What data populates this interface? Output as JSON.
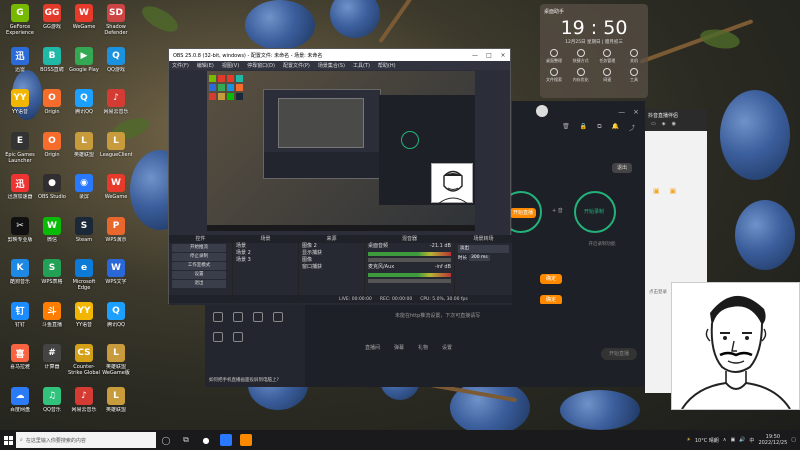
{
  "desktop_icons": [
    {
      "label": "GeForce Experience",
      "color": "#76b900",
      "glyph": "G"
    },
    {
      "label": "GG游戏",
      "color": "#e23a2a",
      "glyph": "GG"
    },
    {
      "label": "WeGame",
      "color": "#e73a2a",
      "glyph": "W"
    },
    {
      "label": "Shadow Defender",
      "color": "#cc4444",
      "glyph": "SD"
    },
    {
      "label": "迅雷",
      "color": "#2a6bd8",
      "glyph": "迅"
    },
    {
      "label": "BOSS直聘",
      "color": "#20b9a8",
      "glyph": "B"
    },
    {
      "label": "Google Play",
      "color": "#34a853",
      "glyph": "▶"
    },
    {
      "label": "QQ游戏",
      "color": "#1a92e0",
      "glyph": "Q"
    },
    {
      "label": "YY语音",
      "color": "#f3b600",
      "glyph": "YY"
    },
    {
      "label": "Origin",
      "color": "#f56c2d",
      "glyph": "O"
    },
    {
      "label": "腾讯QQ",
      "color": "#1ba0ff",
      "glyph": "Q"
    },
    {
      "label": "网易云音乐",
      "color": "#d43c33",
      "glyph": "♪"
    },
    {
      "label": "Epic Games Launcher",
      "color": "#333333",
      "glyph": "E"
    },
    {
      "label": "Origin",
      "color": "#f56c2d",
      "glyph": "O"
    },
    {
      "label": "英雄联盟",
      "color": "#c89b3c",
      "glyph": "L"
    },
    {
      "label": "LeagueClient",
      "color": "#c89b3c",
      "glyph": "L"
    },
    {
      "label": "迅游加速器",
      "color": "#e33",
      "glyph": "迅"
    },
    {
      "label": "OBS Studio",
      "color": "#302e31",
      "glyph": "●"
    },
    {
      "label": "录屏",
      "color": "#2979ff",
      "glyph": "◉"
    },
    {
      "label": "WeGame",
      "color": "#e73a2a",
      "glyph": "W"
    },
    {
      "label": "剪映专业版",
      "color": "#111111",
      "glyph": "✂"
    },
    {
      "label": "微信",
      "color": "#09bb07",
      "glyph": "W"
    },
    {
      "label": "Steam",
      "color": "#1b2838",
      "glyph": "S"
    },
    {
      "label": "WPS演示",
      "color": "#e9662c",
      "glyph": "P"
    },
    {
      "label": "酷狗音乐",
      "color": "#1e88e5",
      "glyph": "K"
    },
    {
      "label": "WPS表格",
      "color": "#22a055",
      "glyph": "S"
    },
    {
      "label": "Microsoft Edge",
      "color": "#0c7bd8",
      "glyph": "e"
    },
    {
      "label": "WPS文字",
      "color": "#2a67d8",
      "glyph": "W"
    },
    {
      "label": "钉钉",
      "color": "#1a8cff",
      "glyph": "钉"
    },
    {
      "label": "斗鱼直播",
      "color": "#ff7d00",
      "glyph": "斗"
    },
    {
      "label": "YY语音",
      "color": "#f3b600",
      "glyph": "YY"
    },
    {
      "label": "腾讯QQ",
      "color": "#1ba0ff",
      "glyph": "Q"
    },
    {
      "label": "喜马拉雅",
      "color": "#f86442",
      "glyph": "喜"
    },
    {
      "label": "计算器",
      "color": "#444444",
      "glyph": "#"
    },
    {
      "label": "Counter-Strike Global",
      "color": "#d4a017",
      "glyph": "CS"
    },
    {
      "label": "英雄联盟 WeGame版",
      "color": "#c89b3c",
      "glyph": "L"
    },
    {
      "label": "百度网盘",
      "color": "#2b7bf6",
      "glyph": "☁"
    },
    {
      "label": "QQ音乐",
      "color": "#31c27c",
      "glyph": "♫"
    },
    {
      "label": "网易云音乐",
      "color": "#d43c33",
      "glyph": "♪"
    },
    {
      "label": "英雄联盟",
      "color": "#c89b3c",
      "glyph": "L"
    }
  ],
  "widget": {
    "title": "桌面助手",
    "time": "19 : 50",
    "date": "12月25日 星期日 | 腊月初三",
    "row1": [
      "桌面整理",
      "快捷方式",
      "任务管理",
      "关机"
    ],
    "row2": [
      "文件搜索",
      "内存优化",
      "网速",
      "工具"
    ]
  },
  "obs": {
    "title": "OBS 25.0.8 (32-bit, windows) - 配置文件: 未命名 - 场景: 未命名",
    "menu": [
      "文件(F)",
      "编辑(E)",
      "视图(V)",
      "停靠窗口(D)",
      "配置文件(P)",
      "场景集合(S)",
      "工具(T)",
      "帮助(H)"
    ],
    "docks": {
      "scenes": {
        "title": "场景",
        "items": [
          "场景",
          "场景 2",
          "场景 3"
        ]
      },
      "sources": {
        "title": "来源",
        "items": [
          "图像 2",
          "显示捕获",
          "图像",
          "窗口捕获"
        ]
      },
      "mixer": {
        "title": "混音器",
        "tracks": [
          {
            "name": "桌面音频",
            "db": "-21.1 dB"
          },
          {
            "name": "麦克风/Aux",
            "db": "-inf dB"
          }
        ]
      },
      "transitions": {
        "title": "场景转场",
        "type": "淡出",
        "duration_label": "时长",
        "duration": "300 ms"
      },
      "controls": {
        "title": "控件",
        "buttons": [
          "开始推流",
          "停止录制",
          "工作室模式",
          "设置",
          "退出"
        ]
      }
    },
    "status": {
      "live": "LIVE: 00:00:00",
      "rec": "REC: 00:00:00",
      "cpu": "CPU: 5.0%, 30.00 fps"
    }
  },
  "dark_app": {
    "close": "退出",
    "start_btn": "开始直播",
    "btn2": "开始录制",
    "status": "未能在http推流设置，下次可直接请写",
    "bottom_items": [
      "直播间",
      "弹幕",
      "礼物",
      "设置"
    ],
    "start_live": "开始直播",
    "banner": "如何把手机直播画面投屏到电脑上?"
  },
  "white_app": {
    "title": "抖音直播伴侣",
    "text": "点击登录"
  },
  "taskbar": {
    "search_placeholder": "在这里输入你要搜索的内容",
    "weather": "10°C 晴朗",
    "ime": "中",
    "time": "19:50",
    "date": "2022/12/25"
  }
}
